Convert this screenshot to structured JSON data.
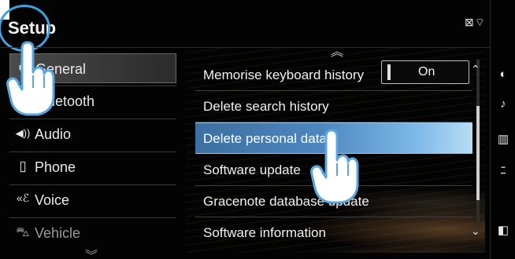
{
  "header": {
    "title": "Setup",
    "status_icons": "⊠⌔"
  },
  "sidebar": {
    "items": [
      {
        "label": "General",
        "icon": "⚙"
      },
      {
        "label": "Bluetooth",
        "icon": "✱"
      },
      {
        "label": "Audio",
        "icon": "◀))"
      },
      {
        "label": "Phone",
        "icon": "▯"
      },
      {
        "label": "Voice",
        "icon": "«ℰ"
      },
      {
        "label": "Vehicle",
        "icon": "⛍"
      }
    ],
    "more_icon": "︾"
  },
  "main": {
    "up_arrow": "︽",
    "rows": [
      {
        "label": "Memorise keyboard history"
      },
      {
        "label": "Delete search history"
      },
      {
        "label": "Delete personal data"
      },
      {
        "label": "Software update"
      },
      {
        "label": "Gracenote database update"
      },
      {
        "label": "Software information"
      }
    ],
    "toggle_value": "On",
    "scroll_up": "⌃",
    "scroll_down": "⌄"
  },
  "rail": {
    "icons": [
      "◐",
      "♪",
      "▥",
      "ﾆ",
      "◧"
    ]
  }
}
